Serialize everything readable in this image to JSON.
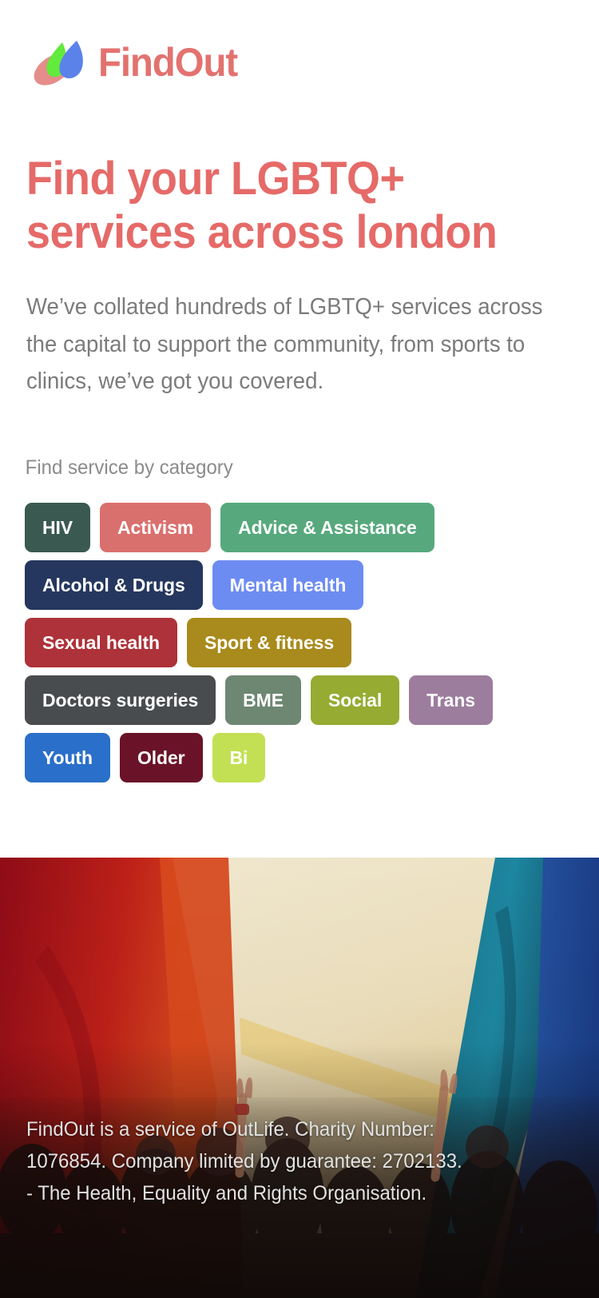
{
  "brand": {
    "name": "FindOut",
    "logo_colors": {
      "petal_pink": "#e58d8b",
      "petal_green": "#62ea3c",
      "petal_blue": "#5b82e8",
      "wordmark": "#e3726f"
    }
  },
  "hero": {
    "title_line1": "Find your LGBTQ+",
    "title_line2": "services across london",
    "title_color": "#e56a68",
    "subtitle": "We’ve collated hundreds of LGBTQ+ services across the capital to support the community, from sports to clinics, we’ve got you covered.",
    "subtitle_color": "#7b7b7b"
  },
  "categories": {
    "label": "Find service by category",
    "items": [
      {
        "label": "HIV",
        "color": "#3a5a51"
      },
      {
        "label": "Activism",
        "color": "#d9706e"
      },
      {
        "label": "Advice & Assistance",
        "color": "#57a97d"
      },
      {
        "label": "Alcohol & Drugs",
        "color": "#25375e"
      },
      {
        "label": "Mental health",
        "color": "#6d8cf2"
      },
      {
        "label": "Sexual health",
        "color": "#ad3239"
      },
      {
        "label": "Sport & fitness",
        "color": "#a98a1c"
      },
      {
        "label": "Doctors surgeries",
        "color": "#494c4f"
      },
      {
        "label": "BME",
        "color": "#6d8772"
      },
      {
        "label": "Social",
        "color": "#95ab32"
      },
      {
        "label": "Trans",
        "color": "#9c7d9d"
      },
      {
        "label": "Youth",
        "color": "#2a6fc9"
      },
      {
        "label": "Older",
        "color": "#6a1328"
      },
      {
        "label": "Bi",
        "color": "#c3e054"
      }
    ]
  },
  "footer": {
    "text": "FindOut is a service of OutLife. Charity Number: 1076854. Company limited by guarantee: 2702133.  - The Health, Equality and Rights Organisation.",
    "photo_alt": "crowd holding large rainbow pride flag",
    "photo_colors": {
      "flag_red": "#a80f1c",
      "flag_orange": "#d8491d",
      "flag_yellow": "#e9d39a",
      "flag_cream": "#efe4c8",
      "flag_teal": "#1d7f96",
      "flag_blue": "#2456a8",
      "crowd_dark": "#2a1c1c"
    }
  }
}
